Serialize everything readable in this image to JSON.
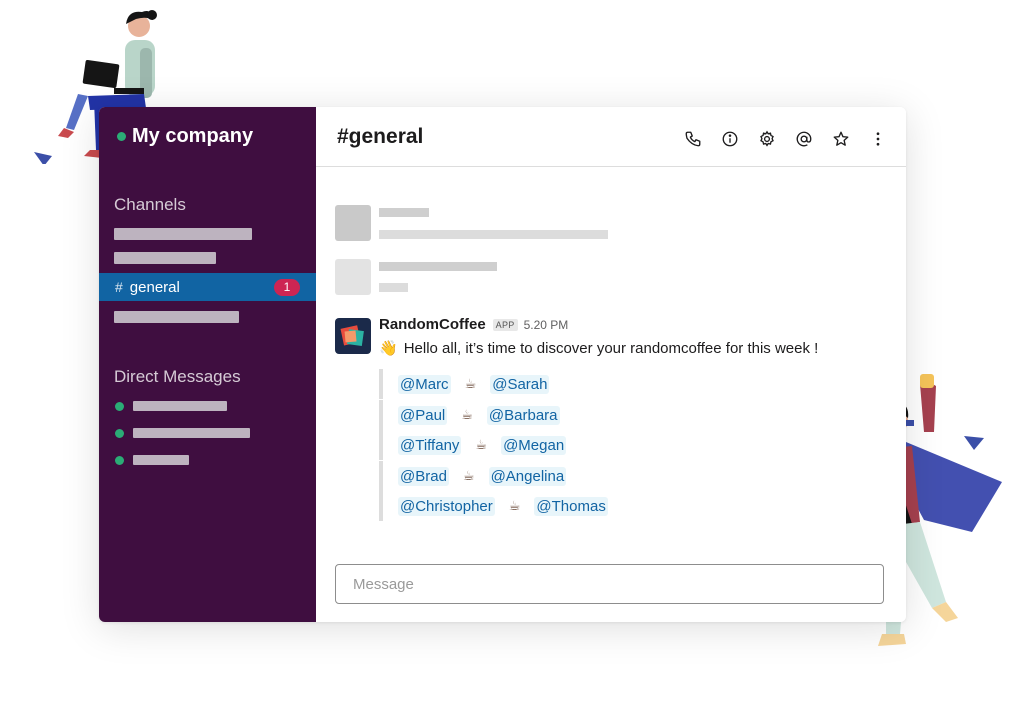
{
  "workspace": {
    "name": "My company",
    "status_color": "#2bac76"
  },
  "sidebar": {
    "channels_title": "Channels",
    "active_channel": {
      "hash": "#",
      "name": "general",
      "unread": "1"
    },
    "direct_messages_title": "Direct Messages",
    "colors": {
      "background": "#3f0e40",
      "active": "#1164a3",
      "badge": "#cd2553"
    }
  },
  "header": {
    "channel_title": "#general",
    "icons": [
      "phone-icon",
      "info-icon",
      "gear-icon",
      "at-icon",
      "star-icon",
      "more-icon"
    ]
  },
  "message": {
    "author": "RandomCoffee",
    "badge": "APP",
    "time": "5.20 PM",
    "emoji": "👋",
    "text": "Hello all, it’s time to discover your randomcoffee for this week !",
    "pairs": [
      {
        "a": "@Marc",
        "b": "@Sarah"
      },
      {
        "a": "@Paul",
        "b": "@Barbara"
      },
      {
        "a": "@Tiffany",
        "b": "@Megan"
      },
      {
        "a": "@Brad",
        "b": "@Angelina"
      },
      {
        "a": "@Christopher",
        "b": "@Thomas"
      }
    ],
    "separator": "☕"
  },
  "composer": {
    "placeholder": "Message"
  }
}
